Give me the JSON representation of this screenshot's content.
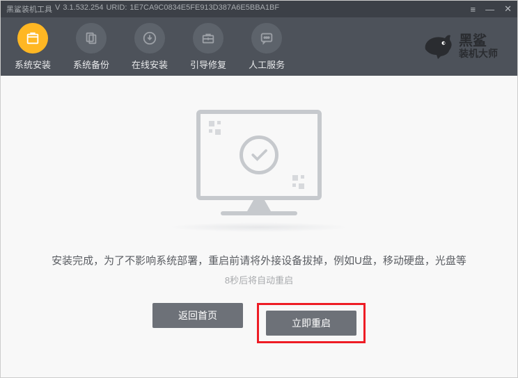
{
  "titlebar": {
    "app_name": "黑鲨装机工具",
    "version_prefix": "V",
    "version": "3.1.532.254",
    "urid_prefix": "URID:",
    "urid": "1E7CA9C0834E5FE913D387A6E5BBA1BF"
  },
  "brand": {
    "line1": "黑鲨",
    "line2": "装机大师"
  },
  "nav": [
    {
      "label": "系统安装",
      "icon": "package-icon",
      "active": true
    },
    {
      "label": "系统备份",
      "icon": "files-icon",
      "active": false
    },
    {
      "label": "在线安装",
      "icon": "download-icon",
      "active": false
    },
    {
      "label": "引导修复",
      "icon": "toolbox-icon",
      "active": false
    },
    {
      "label": "人工服务",
      "icon": "chat-icon",
      "active": false
    }
  ],
  "content": {
    "message": "安装完成，为了不影响系统部署，重启前请将外接设备拔掉，例如U盘，移动硬盘，光盘等",
    "countdown": "8秒后将自动重启",
    "back_button": "返回首页",
    "restart_button": "立即重启"
  }
}
